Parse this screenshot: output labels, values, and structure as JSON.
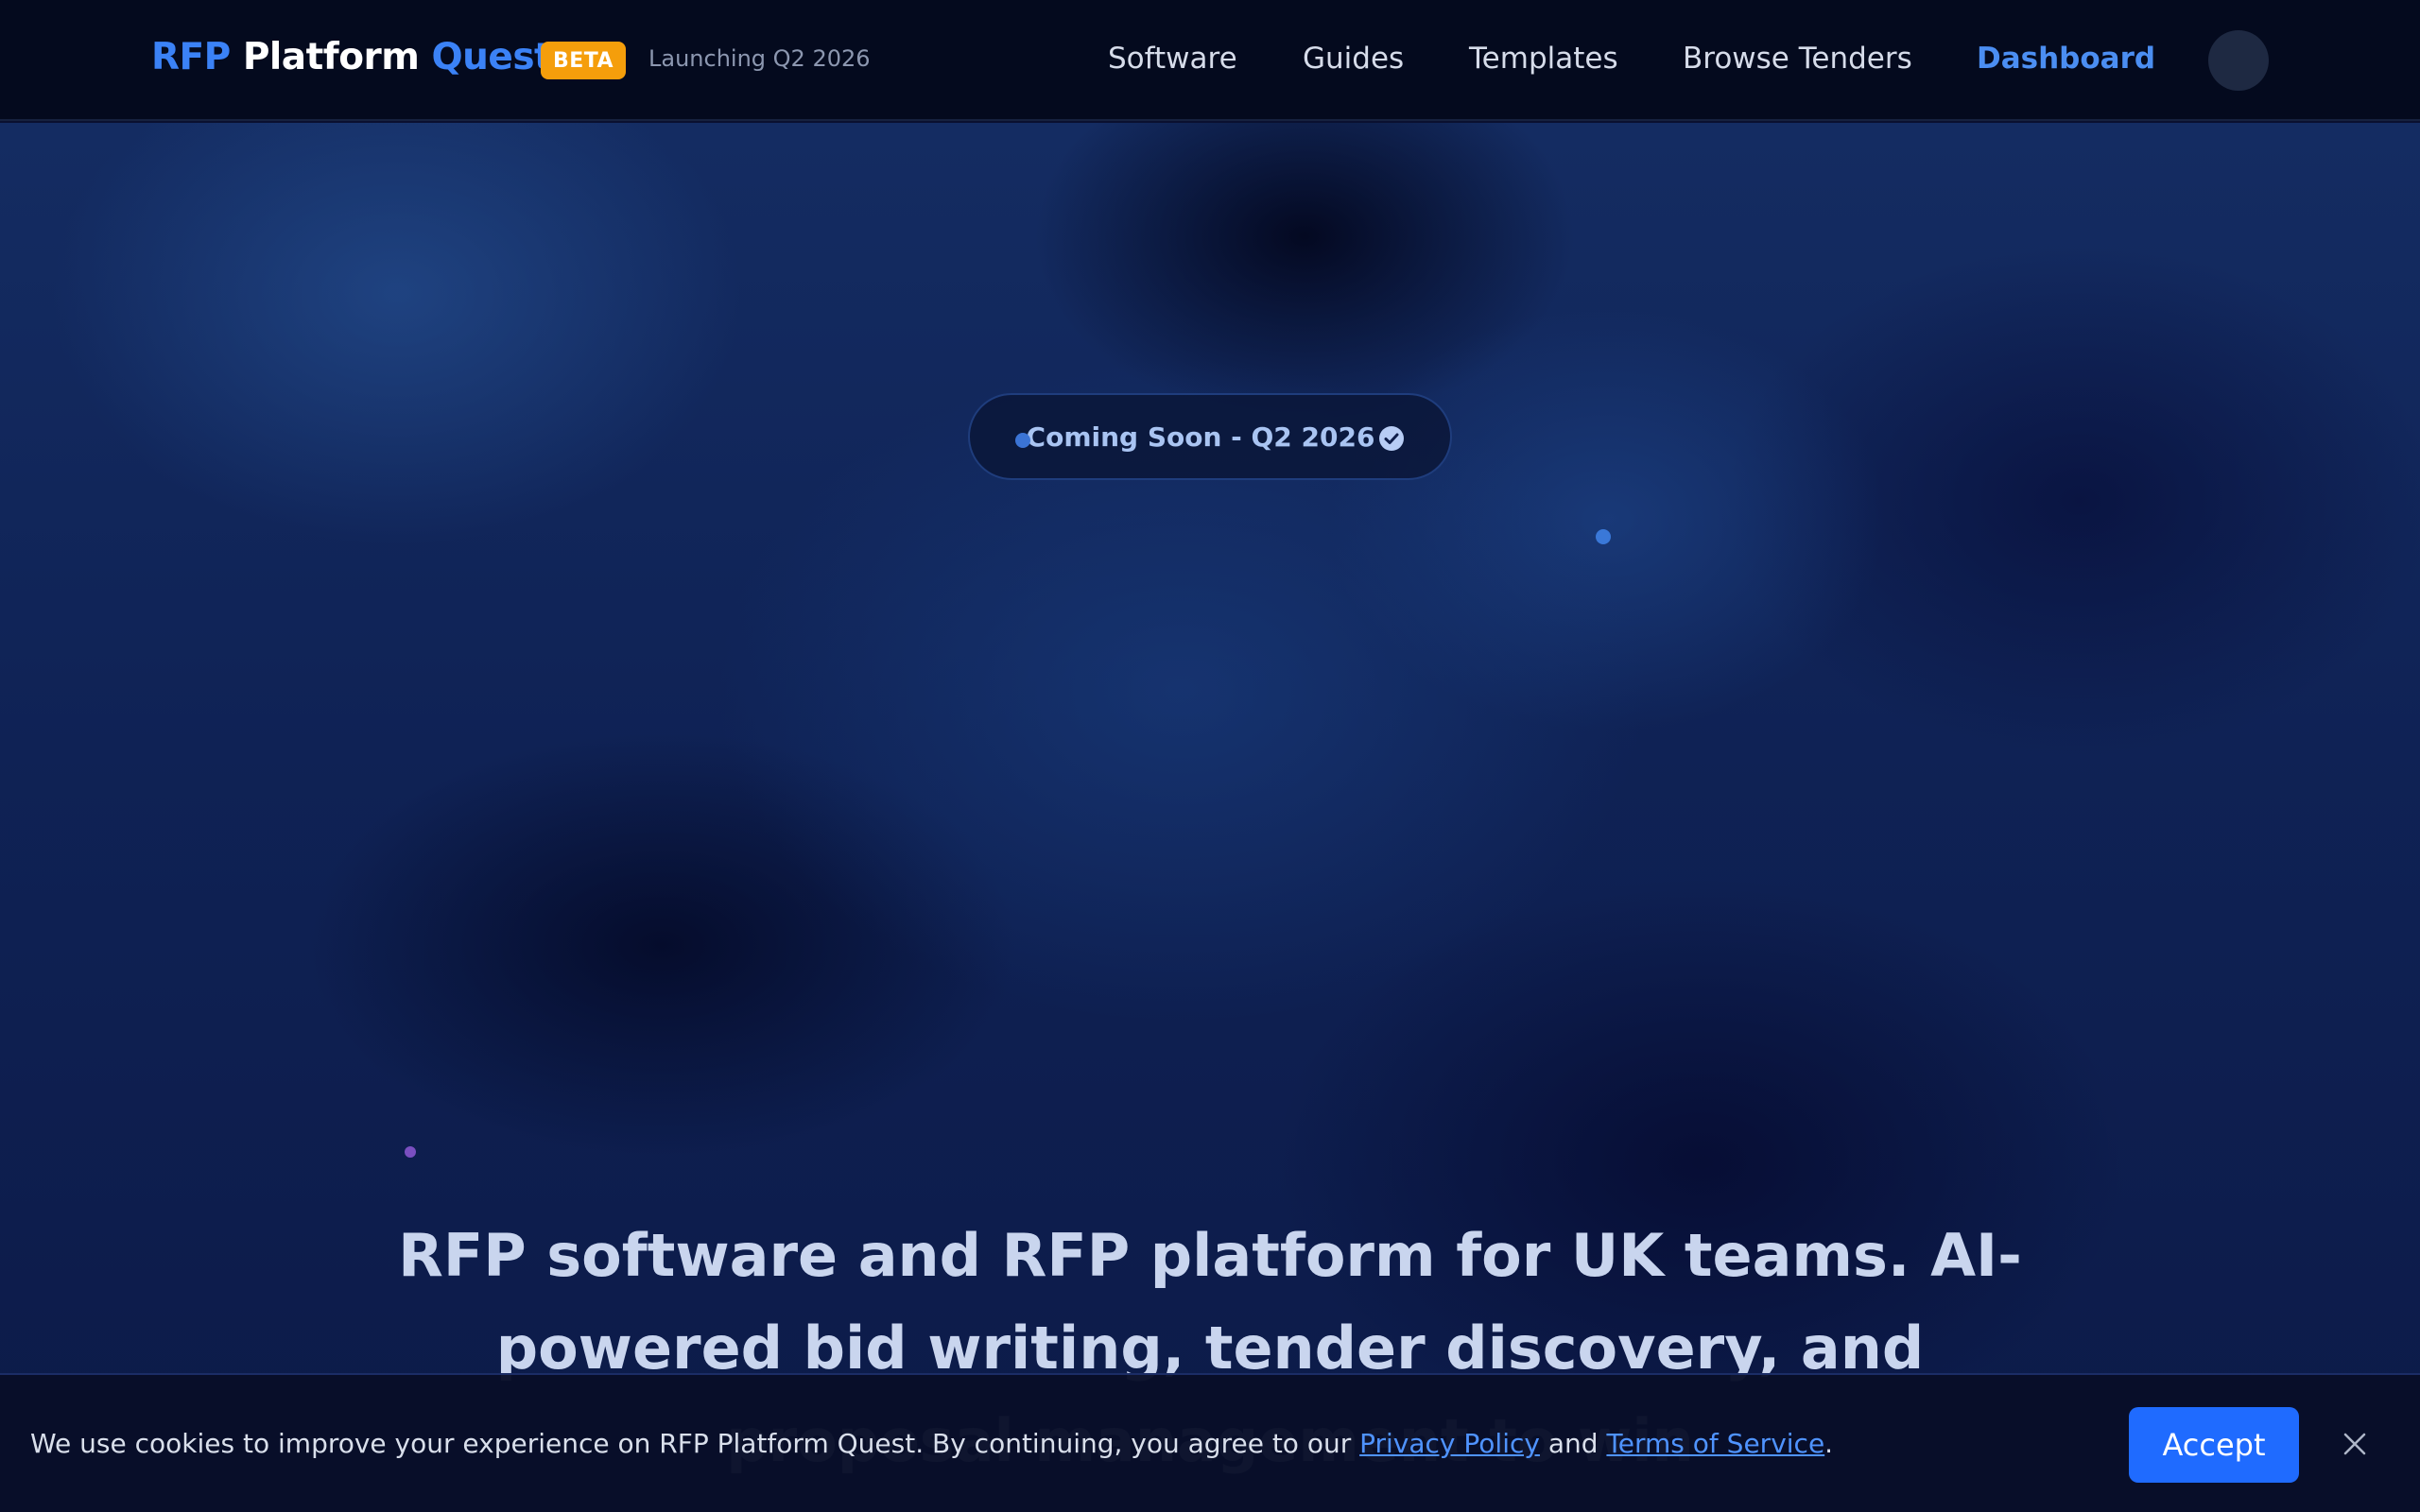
{
  "header": {
    "brand": {
      "part1": "RFP",
      "part2": "Platform",
      "part3": "Quest"
    },
    "beta_badge": "BETA",
    "launching_text": "Launching Q2 2026",
    "nav": [
      {
        "label": "Software"
      },
      {
        "label": "Guides"
      },
      {
        "label": "Templates"
      },
      {
        "label": "Browse Tenders"
      },
      {
        "label": "Dashboard",
        "active": true
      }
    ]
  },
  "hero": {
    "badge_text": "Coming Soon - Q2 2026",
    "headline": "RFP software and RFP platform for UK teams. AI-powered bid writing, tender discovery, and proposal management to win"
  },
  "cookie": {
    "text_before": "We use cookies to improve your experience on RFP Platform Quest. By continuing, you agree to our ",
    "privacy_link": "Privacy Policy",
    "text_middle": " and ",
    "terms_link": "Terms of Service",
    "text_after": ".",
    "accept_label": "Accept"
  },
  "colors": {
    "accent": "#3b82f6",
    "beta": "#f59e0b",
    "accept_button": "#1f6bff",
    "header_bg": "#040a1e"
  },
  "icons": {
    "badge_check": "check-circle-icon",
    "cookie_close": "close-icon"
  }
}
